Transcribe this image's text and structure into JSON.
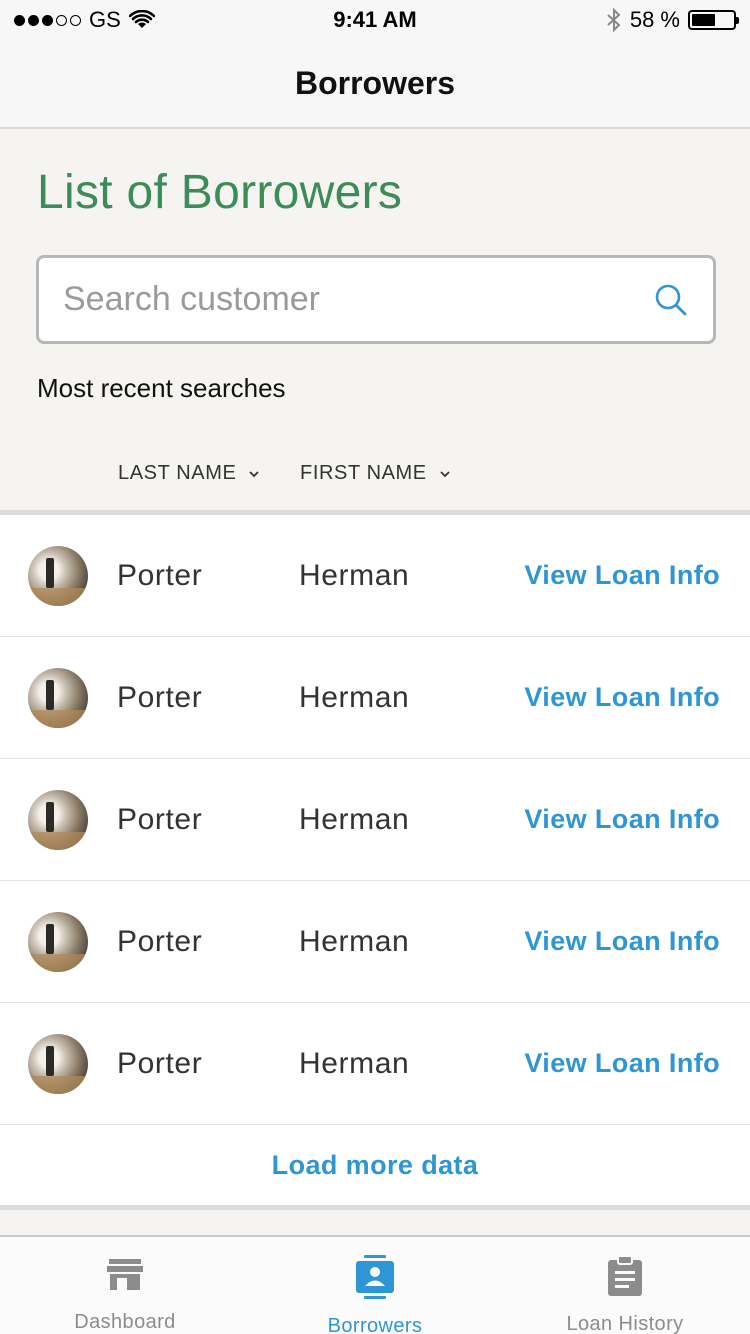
{
  "status_bar": {
    "carrier": "GS",
    "time": "9:41 AM",
    "battery_percent": "58 %",
    "battery_level": 0.58
  },
  "nav": {
    "title": "Borrowers"
  },
  "heading": "List of Borrowers",
  "search": {
    "placeholder": "Search customer",
    "value": "",
    "icon": "search-icon"
  },
  "recent_label": "Most recent searches",
  "columns": {
    "last_name": "LAST NAME",
    "first_name": "FIRST NAME"
  },
  "rows": [
    {
      "last": "Porter",
      "first": "Herman",
      "action": "View Loan Info"
    },
    {
      "last": "Porter",
      "first": "Herman",
      "action": "View Loan Info"
    },
    {
      "last": "Porter",
      "first": "Herman",
      "action": "View Loan Info"
    },
    {
      "last": "Porter",
      "first": "Herman",
      "action": "View Loan Info"
    },
    {
      "last": "Porter",
      "first": "Herman",
      "action": "View Loan Info"
    }
  ],
  "load_more": "Load more data",
  "tabs": [
    {
      "label": "Dashboard",
      "icon": "store-icon",
      "active": false
    },
    {
      "label": "Borrowers",
      "icon": "contact-badge-icon",
      "active": true
    },
    {
      "label": "Loan History",
      "icon": "clipboard-icon",
      "active": false
    }
  ],
  "colors": {
    "accent": "#2f96d6",
    "heading_green": "#3c8c5a",
    "inactive": "#8c8c8c"
  }
}
